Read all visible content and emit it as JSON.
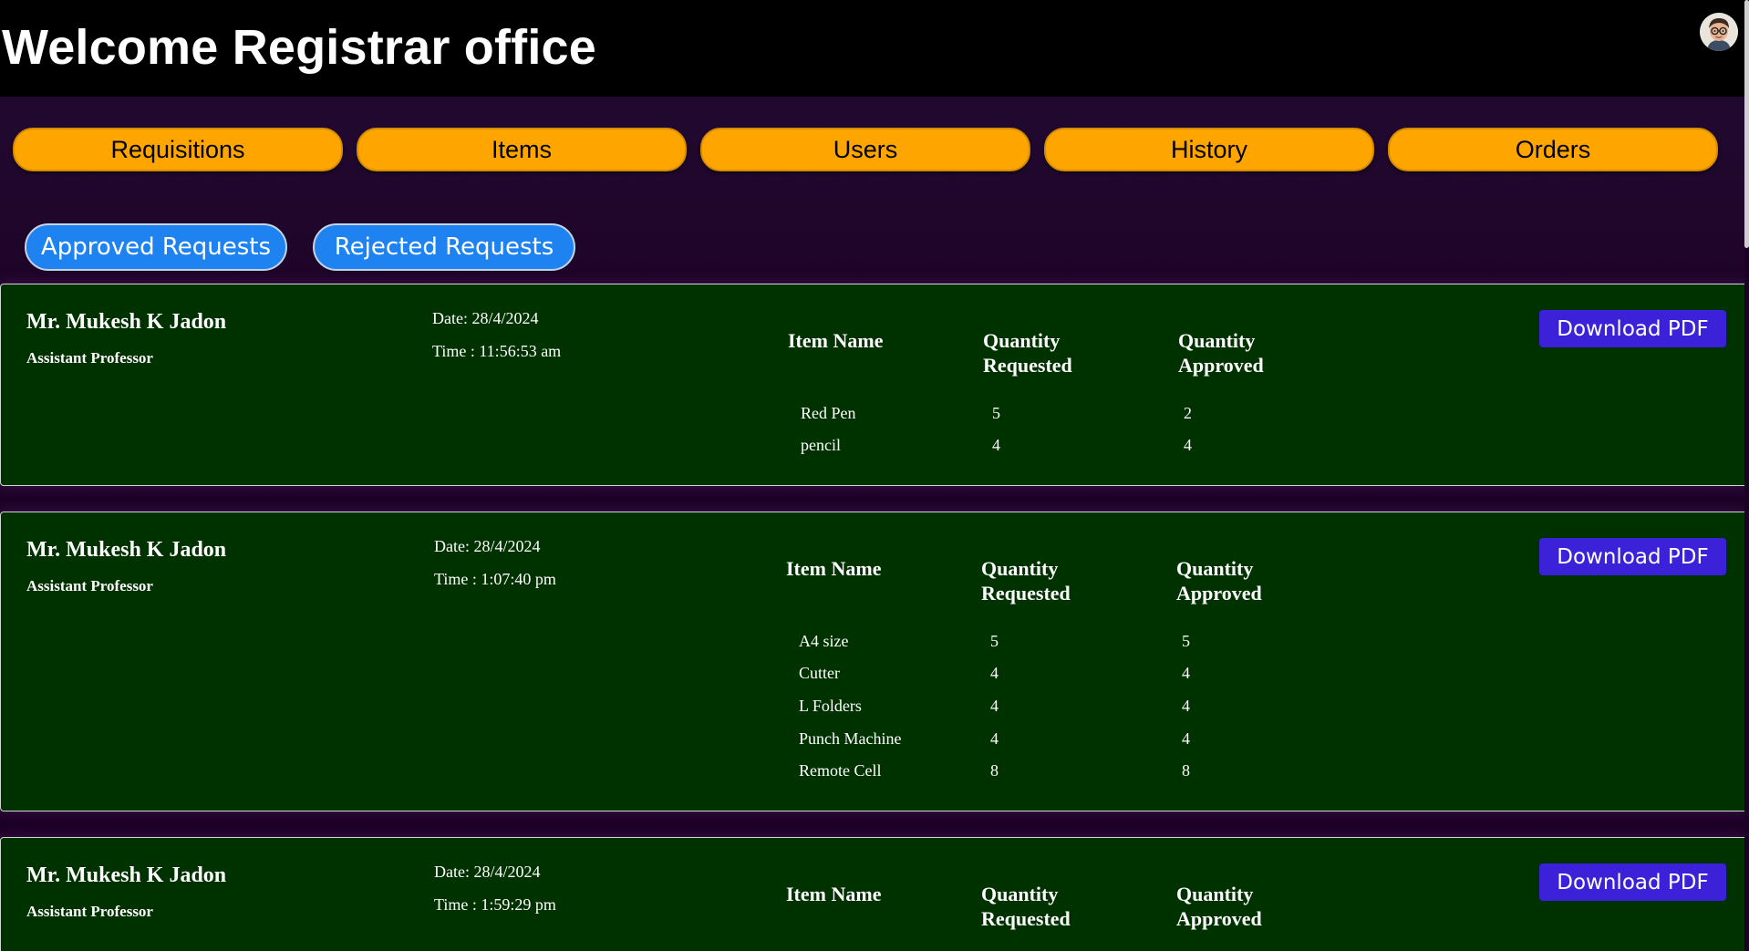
{
  "header": {
    "title": "Welcome Registrar office",
    "avatar_icon": "user-avatar-icon"
  },
  "nav": {
    "items": [
      "Requisitions",
      "Items",
      "Users",
      "History",
      "Orders"
    ],
    "color": "#ffa500"
  },
  "tabs": {
    "approved_label": "Approved Requests",
    "rejected_label": "Rejected Requests",
    "color": "#1e83f0"
  },
  "table_headers": {
    "item_name": "Item Name",
    "qty_requested_1": "Quantity",
    "qty_requested_2": "Requested",
    "qty_approved_1": "Quantity",
    "qty_approved_2": "Approved"
  },
  "download_label": "Download PDF",
  "requests": [
    {
      "name": "Mr. Mukesh K Jadon",
      "role": "Assistant Professor",
      "date": "Date: 28/4/2024",
      "time": "Time : 11:56:53 am",
      "items": [
        {
          "item": "Red Pen",
          "requested": "5",
          "approved": "2"
        },
        {
          "item": "pencil",
          "requested": "4",
          "approved": "4"
        }
      ]
    },
    {
      "name": "Mr. Mukesh K Jadon",
      "role": "Assistant Professor",
      "date": "Date: 28/4/2024",
      "time": "Time : 1:07:40 pm",
      "items": [
        {
          "item": "A4 size",
          "requested": "5",
          "approved": "5"
        },
        {
          "item": "Cutter",
          "requested": "4",
          "approved": "4"
        },
        {
          "item": "L Folders",
          "requested": "4",
          "approved": "4"
        },
        {
          "item": "Punch Machine",
          "requested": "4",
          "approved": "4"
        },
        {
          "item": "Remote Cell",
          "requested": "8",
          "approved": "8"
        }
      ]
    },
    {
      "name": "Mr. Mukesh K Jadon",
      "role": "Assistant Professor",
      "date": "Date: 28/4/2024",
      "time": "Time : 1:59:29 pm",
      "items": []
    }
  ]
}
